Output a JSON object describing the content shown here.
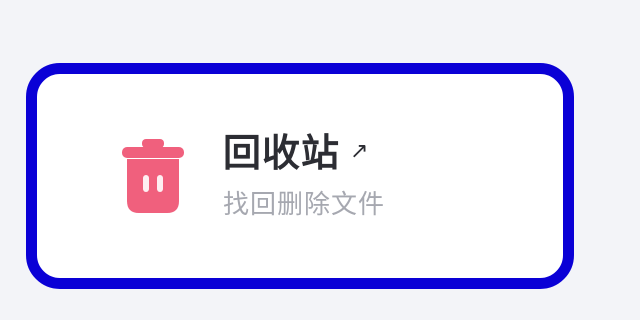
{
  "card": {
    "title": "回收站",
    "subtitle": "找回删除文件",
    "arrow_icon": "arrow-up-right-icon",
    "trash_icon": "trash-bin-icon"
  },
  "colors": {
    "accent_outline": "#0a00d6",
    "icon_pink": "#f0607d",
    "title_text": "#2c2d33",
    "subtitle_text": "#a6a8b0",
    "card_bg": "#ffffff",
    "page_bg": "#f3f4f8"
  }
}
